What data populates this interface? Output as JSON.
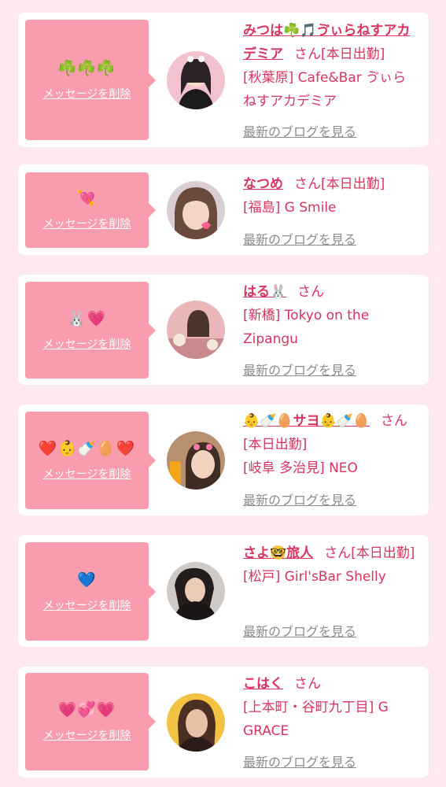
{
  "colors": {
    "page_bg": "#fde9ee",
    "accent": "#d8345f",
    "bubble": "#f99cad",
    "muted": "#8c8c8c"
  },
  "cards": [
    {
      "bubble_emoji": "☘️☘️☘️",
      "delete_label": "メッセージを削除",
      "name": "みつは☘️🎵ゔぃらねすアカデミア",
      "honorific": "さん",
      "status": "[本日出勤]",
      "location": "[秋葉原] Cafe&Bar ゔぃらねすアカデミア",
      "blog_label": "最新のブログを見る"
    },
    {
      "bubble_emoji": "💘",
      "delete_label": "メッセージを削除",
      "name": "なつめ",
      "honorific": "さん",
      "status": "[本日出勤]",
      "location": "[福島] G Smile",
      "blog_label": "最新のブログを見る"
    },
    {
      "bubble_emoji": "🐰💗",
      "delete_label": "メッセージを削除",
      "name": "はる🐰",
      "honorific": "さん",
      "status": "",
      "location": "[新橋] Tokyo on the Zipangu",
      "blog_label": "最新のブログを見る"
    },
    {
      "bubble_emoji": "❤️👶🍼🥚❤️",
      "delete_label": "メッセージを削除",
      "name": "👶🍼🥚サヨ👶🍼🥚",
      "honorific": "さん",
      "status": "[本日出勤]",
      "location": "[岐阜 多治見] NEO",
      "blog_label": "最新のブログを見る"
    },
    {
      "bubble_emoji": "💙",
      "delete_label": "メッセージを削除",
      "name": "さよ🤓旅人",
      "honorific": "さん",
      "status": "[本日出勤]",
      "location": "[松戸] Girl'sBar Shelly",
      "blog_label": "最新のブログを見る"
    },
    {
      "bubble_emoji": "💗💞💗",
      "delete_label": "メッセージを削除",
      "name": "こはく",
      "honorific": "さん",
      "status": "",
      "location": "[上本町・谷町九丁目] G GRACE",
      "blog_label": "最新のブログを見る"
    }
  ]
}
